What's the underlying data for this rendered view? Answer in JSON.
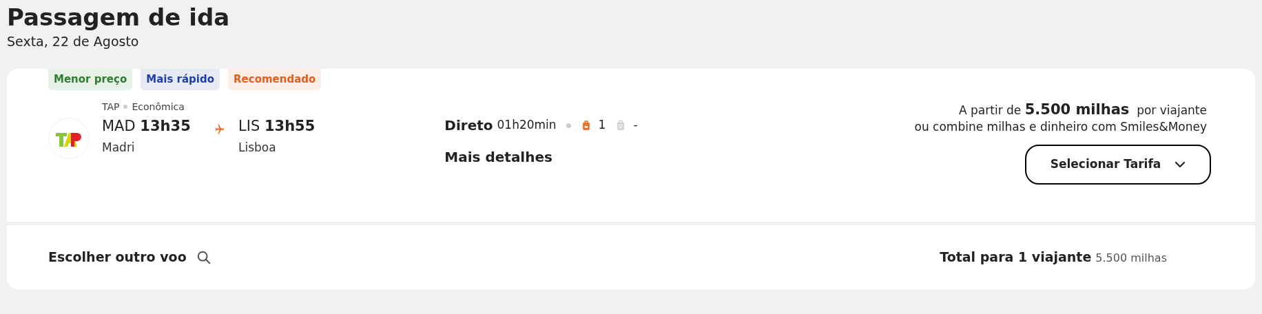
{
  "title": "Passagem de ida",
  "subtitle": "Sexta, 22 de Agosto",
  "tags": [
    {
      "label": "Menor preço",
      "color": "#2e7d32"
    },
    {
      "label": "Mais rápido",
      "color": "#1f3ea8"
    },
    {
      "label": "Recomendado",
      "color": "#e0601f"
    }
  ],
  "flight": {
    "carrier": "TAP",
    "cabin": "Econômica",
    "origin": {
      "code": "MAD",
      "time": "13h35",
      "city": "Madri"
    },
    "destination": {
      "code": "LIS",
      "time": "13h55",
      "city": "Lisboa"
    },
    "stops": "Direto",
    "duration": "01h20min",
    "bags": [
      {
        "kind": "backpack",
        "included": true,
        "count": "1"
      },
      {
        "kind": "suitcase",
        "included": false,
        "count": "-"
      }
    ],
    "details_link": "Mais detalhes"
  },
  "price": {
    "line_1": "A partir de **5.500 milhas**  por viajante",
    "line_2": "ou combine milhas e dinheiro com Smiles&Money",
    "button": "Selecionar Tarifa"
  },
  "footer": {
    "change_flight": "Escolher outro voo",
    "total_label": "Total para 1 viajante",
    "total_value": "5.500 milhas"
  }
}
